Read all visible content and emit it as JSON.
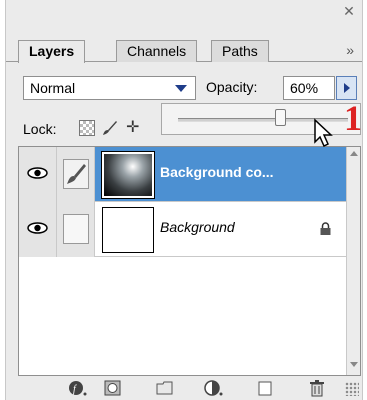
{
  "window": {
    "close_icon": "close-x-icon"
  },
  "tabs": [
    {
      "label": "Layers",
      "active": true
    },
    {
      "label": "Channels",
      "active": false
    },
    {
      "label": "Paths",
      "active": false
    }
  ],
  "tabs_menu_icon": "double-chevron-right-icon",
  "blend": {
    "mode": "Normal",
    "dropdown_icon": "triangle-down-icon"
  },
  "opacity": {
    "label": "Opacity:",
    "value": "60%",
    "slider_value": 60
  },
  "lock": {
    "label": "Lock:"
  },
  "annotation": {
    "step": "1"
  },
  "layers": [
    {
      "name": "Background co...",
      "selected": true,
      "visible": true,
      "thumbnail": "gradient"
    },
    {
      "name": "Background",
      "selected": false,
      "visible": true,
      "thumbnail": "white",
      "locked": true
    }
  ],
  "colors": {
    "selection": "#4c90d2",
    "annotation": "#dd2222",
    "panel": "#ebebeb"
  }
}
